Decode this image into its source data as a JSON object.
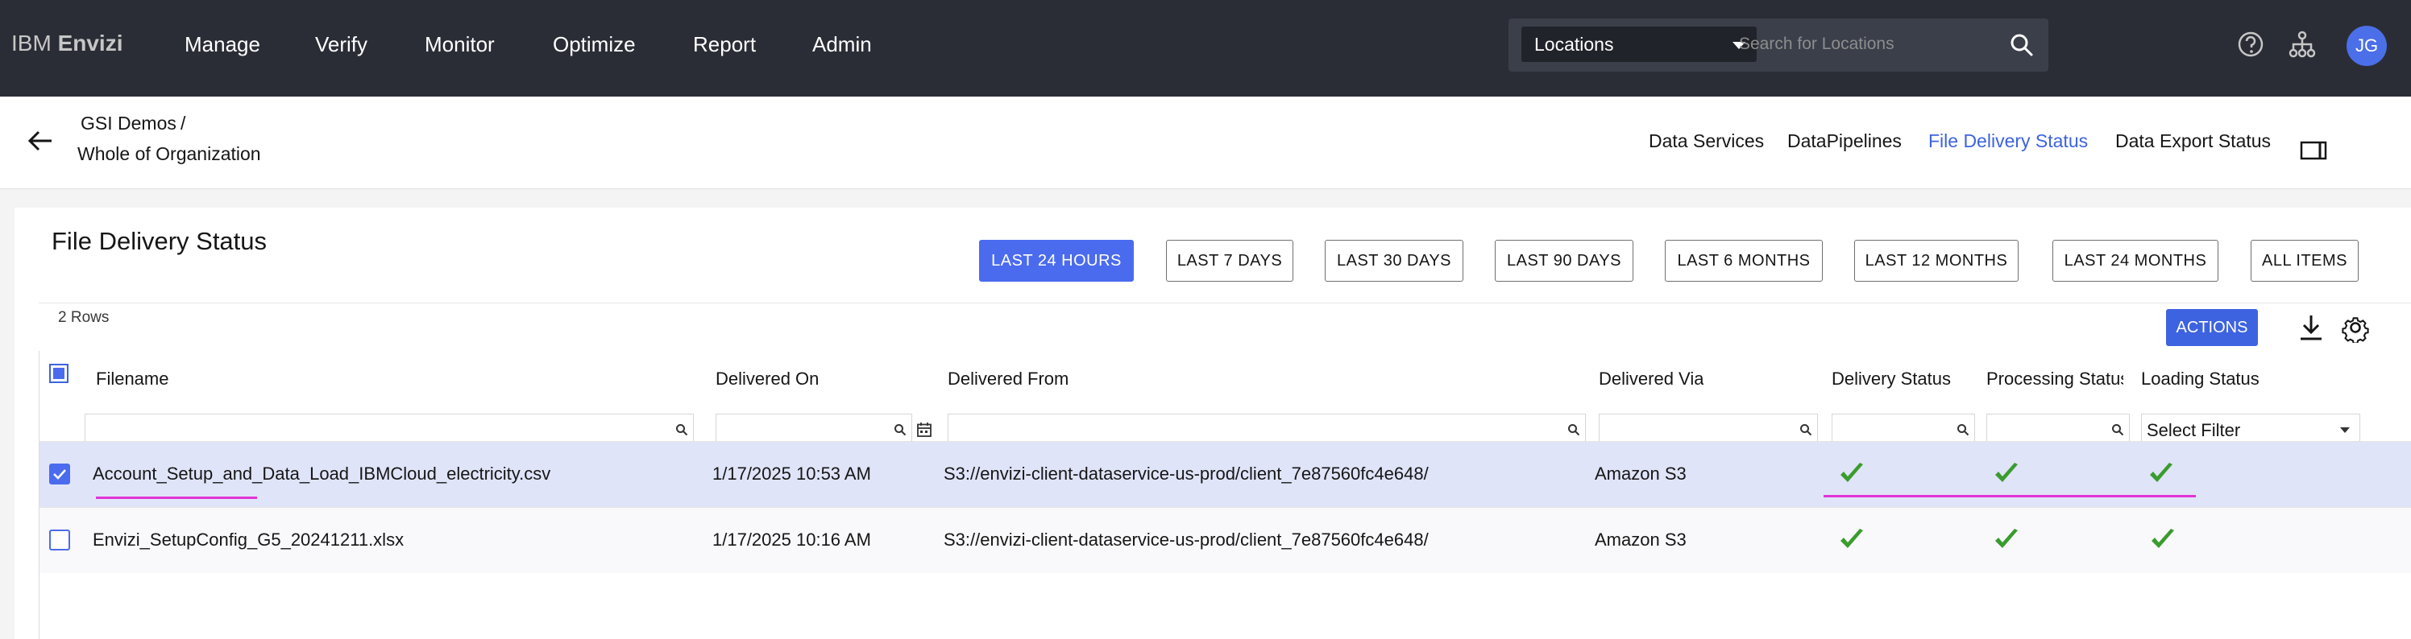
{
  "app": {
    "brand_prefix": "IBM",
    "brand_name": "Envizi"
  },
  "nav": {
    "items": [
      "Manage",
      "Verify",
      "Monitor",
      "Optimize",
      "Report",
      "Admin"
    ]
  },
  "search": {
    "scope": "Locations",
    "placeholder": "Search for Locations"
  },
  "user": {
    "initials": "JG"
  },
  "breadcrumb": {
    "level1": "GSI Demos",
    "separator": "/",
    "level2": "Whole of Organization"
  },
  "tabs": {
    "items": [
      {
        "label": "Data Services",
        "active": false
      },
      {
        "label": "DataPipelines",
        "active": false
      },
      {
        "label": "File Delivery Status",
        "active": true
      },
      {
        "label": "Data Export Status",
        "active": false
      }
    ]
  },
  "page": {
    "title": "File Delivery Status"
  },
  "time_ranges": {
    "items": [
      "LAST 24 HOURS",
      "LAST 7 DAYS",
      "LAST 30 DAYS",
      "LAST 90 DAYS",
      "LAST 6 MONTHS",
      "LAST 12 MONTHS",
      "LAST 24 MONTHS",
      "ALL ITEMS"
    ],
    "selected": "LAST 24 HOURS"
  },
  "grid": {
    "row_count": "2 Rows",
    "actions_label": "ACTIONS",
    "columns": [
      "Filename",
      "Delivered On",
      "Delivered From",
      "Delivered Via",
      "Delivery Status",
      "Processing Status",
      "Loading Status"
    ],
    "loading_filter": "Select Filter",
    "rows": [
      {
        "selected": true,
        "filename": "Account_Setup_and_Data_Load_IBMCloud_electricity.csv",
        "delivered_on": "1/17/2025 10:53 AM",
        "delivered_from": "S3://envizi-client-dataservice-us-prod/client_7e87560fc4e648/",
        "delivered_via": "Amazon S3",
        "delivery_status": "success",
        "processing_status": "success",
        "loading_status": "success"
      },
      {
        "selected": false,
        "filename": "Envizi_SetupConfig_G5_20241211.xlsx",
        "delivered_on": "1/17/2025 10:16 AM",
        "delivered_from": "S3://envizi-client-dataservice-us-prod/client_7e87560fc4e648/",
        "delivered_via": "Amazon S3",
        "delivery_status": "success",
        "processing_status": "success",
        "loading_status": "success"
      }
    ]
  },
  "colors": {
    "accent": "#4b6bee",
    "success": "#3a9c2e",
    "highlight": "#e233d6",
    "topbar": "#2b2d36"
  }
}
